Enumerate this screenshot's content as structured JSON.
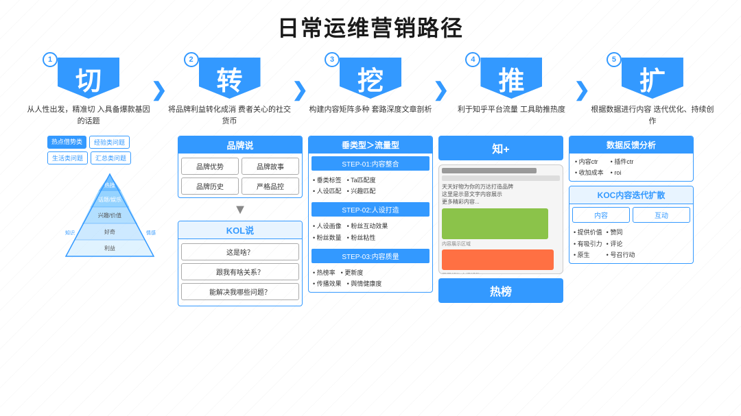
{
  "title": "日常运维营销路径",
  "steps": [
    {
      "num": "1",
      "char": "切",
      "desc": "从人性出发，精准切\n入具备爆款基因的话题"
    },
    {
      "num": "2",
      "char": "转",
      "desc": "将品牌利益转化成消\n费者关心的社交货币"
    },
    {
      "num": "3",
      "char": "挖",
      "desc": "构建内容矩阵多种\n套路深度文章剖析"
    },
    {
      "num": "4",
      "char": "推",
      "desc": "利于知乎平台流量\n工具助推热度"
    },
    {
      "num": "5",
      "char": "扩",
      "desc": "根据数据进行内容\n迭代优化、持续创作"
    }
  ],
  "panel1": {
    "tags": [
      "热点借势类",
      "经验类问题",
      "生活类问题",
      "汇总类问题"
    ],
    "pyramid_levels": [
      "热搜",
      "话题/娱乐",
      "兴趣/价值",
      "好奇",
      "利益",
      "知识",
      "情感"
    ]
  },
  "panel2": {
    "brand_title": "品牌说",
    "brand_items": [
      "品牌优势",
      "品牌故事",
      "品牌历史",
      "严格品控"
    ],
    "kol_title": "KOL说",
    "kol_items": [
      "这是啥？",
      "跟我有啥关系？",
      "能解决我哪些问题？"
    ]
  },
  "panel3": {
    "title": "垂类型＞流量型",
    "steps": [
      {
        "label": "STEP-01:内容整合",
        "bullets": [
          [
            "垂类标签",
            "Ta匹配度"
          ],
          [
            "人设匹配",
            "兴趣匹配"
          ]
        ]
      },
      {
        "label": "STEP-02:人设打造",
        "bullets": [
          [
            "人设画像",
            "粉丝互动效果"
          ],
          [
            "粉丝数量",
            "粉丝粘性"
          ]
        ]
      },
      {
        "label": "STEP-03:内容质量",
        "bullets": [
          [
            "热榜率",
            "更新度"
          ],
          [
            "传播效果",
            "舆情健康度"
          ]
        ]
      }
    ]
  },
  "panel4": {
    "zhiplus": "知+",
    "hot": "热榜"
  },
  "panel5": {
    "data_title": "数据反馈分析",
    "data_cols": [
      [
        "内容ctr",
        "收加成本"
      ],
      [
        "插件ctr",
        "roi"
      ]
    ],
    "koc_title": "KOC内容迭代扩散",
    "koc_btns": [
      "内容",
      "互动"
    ],
    "koc_cols": [
      [
        "提供价值",
        "有吸引力",
        "原生"
      ],
      [
        "赞同",
        "评论",
        "号召行动"
      ]
    ]
  }
}
